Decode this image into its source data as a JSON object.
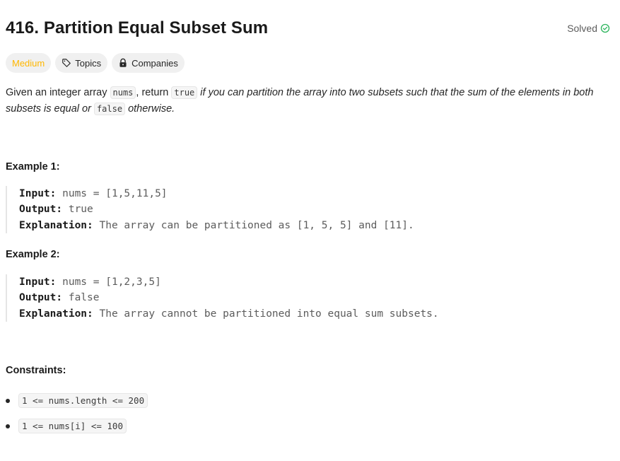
{
  "problem": {
    "title": "416. Partition Equal Subset Sum",
    "status": "Solved",
    "difficulty": "Medium",
    "topics_label": "Topics",
    "companies_label": "Companies"
  },
  "description": {
    "part1": "Given an integer array ",
    "code1": "nums",
    "part2": ", return ",
    "code2": "true",
    "part3": " if you can partition the array into two subsets such that the sum of the elements in both subsets is equal or ",
    "code3": "false",
    "part4": " otherwise."
  },
  "examples": [
    {
      "heading": "Example 1:",
      "input_label": "Input:",
      "input": " nums = [1,5,11,5]",
      "output_label": "Output:",
      "output": " true",
      "explanation_label": "Explanation:",
      "explanation": " The array can be partitioned as [1, 5, 5] and [11]."
    },
    {
      "heading": "Example 2:",
      "input_label": "Input:",
      "input": " nums = [1,2,3,5]",
      "output_label": "Output:",
      "output": " false",
      "explanation_label": "Explanation:",
      "explanation": " The array cannot be partitioned into equal sum subsets."
    }
  ],
  "constraints": {
    "heading": "Constraints:",
    "items": [
      "1 <= nums.length <= 200",
      "1 <= nums[i] <= 100"
    ]
  },
  "colors": {
    "difficulty_medium": "#ffb700",
    "solved_check": "#2db55d"
  },
  "icons": {
    "solved": "check-circle-icon",
    "topics": "tag-icon",
    "companies": "lock-icon"
  }
}
